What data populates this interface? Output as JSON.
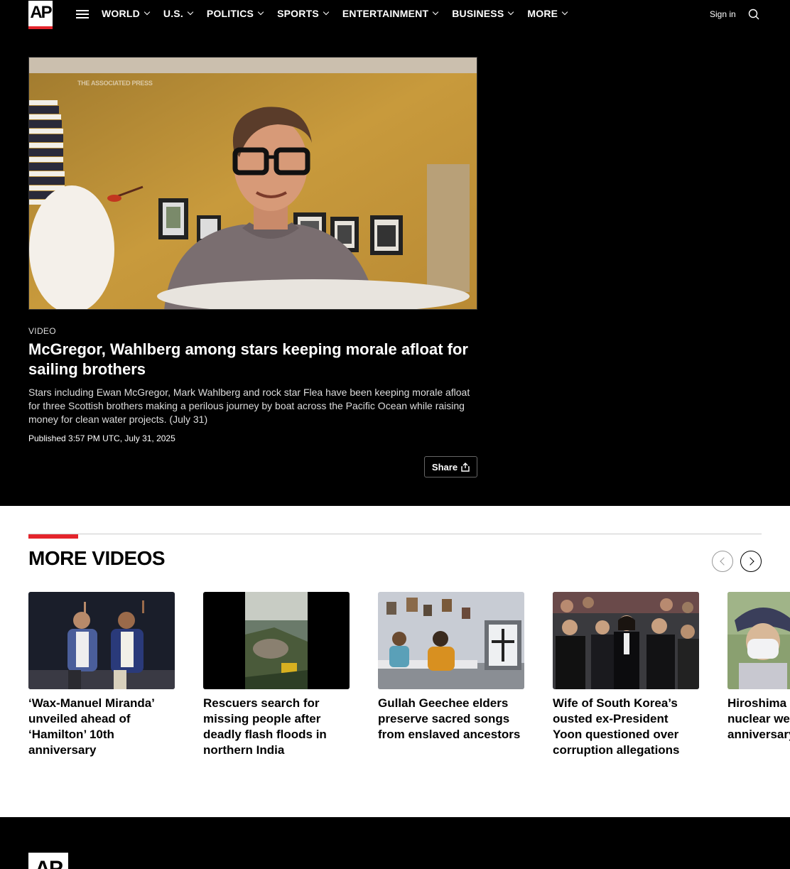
{
  "nav": {
    "logo": "AP",
    "menu": [
      {
        "label": "WORLD"
      },
      {
        "label": "U.S."
      },
      {
        "label": "POLITICS"
      },
      {
        "label": "SPORTS"
      },
      {
        "label": "ENTERTAINMENT"
      },
      {
        "label": "BUSINESS"
      },
      {
        "label": "MORE"
      }
    ],
    "signin": "Sign in"
  },
  "video": {
    "watermark": "THE ASSOCIATED PRESS",
    "kicker": "VIDEO",
    "headline": "McGregor, Wahlberg among stars keeping morale afloat for sailing brothers",
    "description": "Stars including Ewan McGregor, Mark Wahlberg and rock star Flea have been keeping morale afloat for three Scottish brothers making a perilous journey by boat across the Pacific Ocean while raising money for clean water projects. (July 31)",
    "published": "Published 3:57 PM UTC, July 31, 2025",
    "share_label": "Share"
  },
  "more_videos": {
    "title": "MORE VIDEOS",
    "cards": [
      {
        "title": "‘Wax-Manuel Miranda’ unveiled ahead of ‘Hamilton’ 10th anniversary"
      },
      {
        "title": "Rescuers search for missing people after deadly flash floods in northern India"
      },
      {
        "title": "Gullah Geechee elders preserve sacred songs from enslaved ancestors"
      },
      {
        "title": "Wife of South Korea’s ousted ex-President Yoon questioned over corruption allegations"
      },
      {
        "title": "Hiroshima against nuclear weapons on anniversary of bombing"
      }
    ]
  },
  "footer": {
    "logo": "AP"
  },
  "colors": {
    "accent": "#e4252c",
    "nav_bg": "#000000"
  }
}
